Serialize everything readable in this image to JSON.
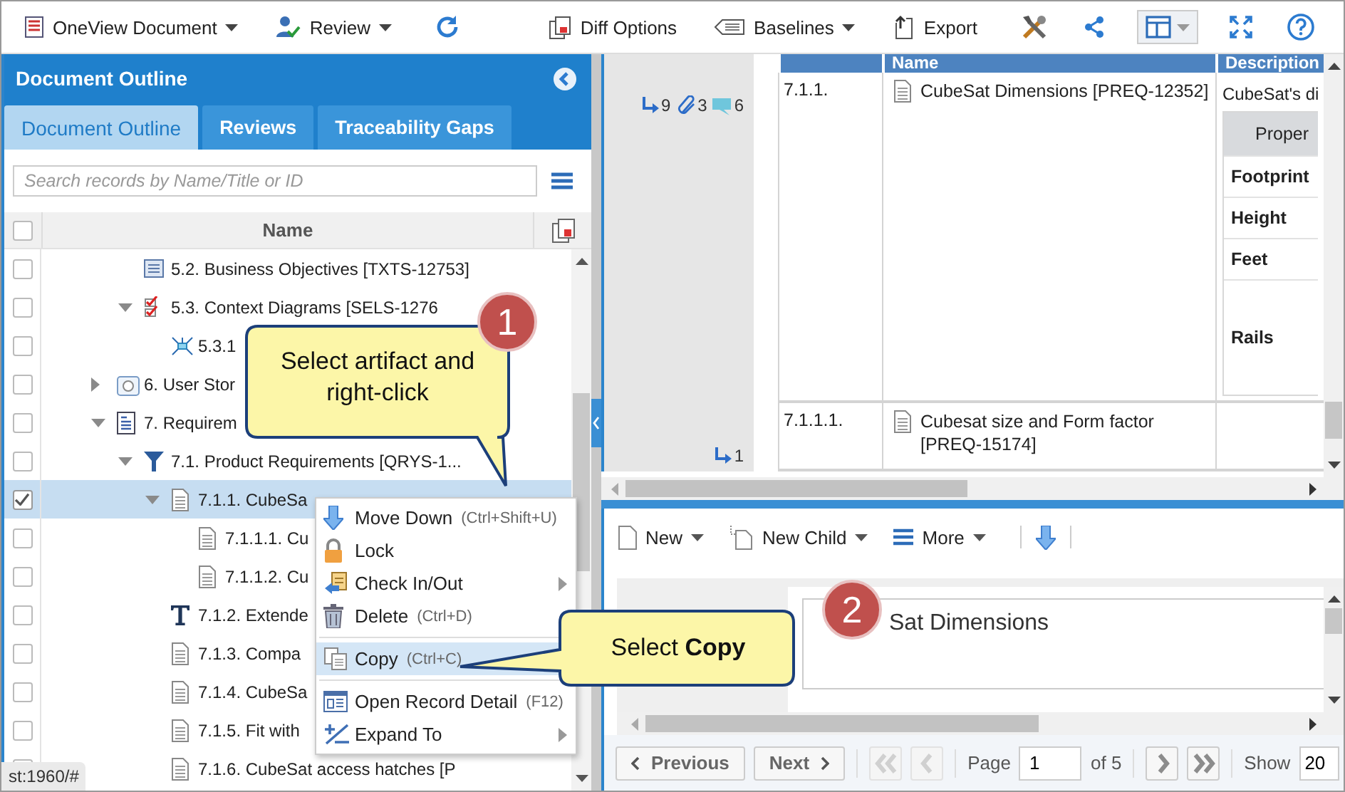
{
  "toolbar": {
    "left": [
      {
        "label": "OneView Document",
        "dropdown": true
      },
      {
        "label": "Review",
        "dropdown": true
      }
    ],
    "right": [
      {
        "label": "Diff Options",
        "dropdown": false
      },
      {
        "label": "Baselines",
        "dropdown": true
      },
      {
        "label": "Export",
        "dropdown": false
      }
    ]
  },
  "outline": {
    "title": "Document Outline",
    "tabs": [
      {
        "label": "Document Outline",
        "selected": true
      },
      {
        "label": "Reviews",
        "selected": false
      },
      {
        "label": "Traceability Gaps",
        "selected": false
      }
    ],
    "search": {
      "placeholder": "Search records by Name/Title or ID"
    },
    "column": "Name",
    "all_checked": false,
    "tree": [
      {
        "children": [
          {
            "label": "5.2. Business Objectives [TXTS-12753]",
            "kind": "text-list",
            "checked": false,
            "selected": false
          },
          {
            "label": "5.3. Context Diagrams [SELS-1276",
            "kind": "checklist",
            "expanded": true,
            "checked": false,
            "selected": false,
            "children": [
              {
                "label": "5.3.1",
                "kind": "diagram",
                "checked": false,
                "selected": false
              }
            ]
          }
        ]
      },
      {
        "label": "6. User Stor",
        "kind": "story",
        "expanded": false,
        "checked": false,
        "selected": false
      },
      {
        "label": "7. Requirem",
        "kind": "spec",
        "expanded": true,
        "checked": false,
        "selected": false,
        "children": [
          {
            "label": "7.1. Product Requirements [QRYS-1...",
            "kind": "filter",
            "expanded": true,
            "checked": false,
            "selected": false,
            "children": [
              {
                "label": "7.1.1. CubeSa",
                "kind": "page",
                "expanded": true,
                "checked": true,
                "selected": true,
                "children": [
                  {
                    "label": "7.1.1.1. Cu",
                    "kind": "page",
                    "checked": false,
                    "selected": false
                  },
                  {
                    "label": "7.1.1.2. Cu",
                    "kind": "page",
                    "checked": false,
                    "selected": false
                  }
                ]
              },
              {
                "label": "7.1.2. Extende",
                "kind": "text",
                "checked": false,
                "selected": false
              },
              {
                "label": "7.1.3. Compa",
                "kind": "page",
                "checked": false,
                "selected": false
              },
              {
                "label": "7.1.4. CubeSa",
                "kind": "page",
                "checked": false,
                "selected": false
              },
              {
                "label": "7.1.5. Fit with",
                "kind": "page",
                "checked": false,
                "selected": false
              },
              {
                "label": "7.1.6. CubeSat access hatches [P",
                "kind": "page",
                "checked": false,
                "selected": false
              }
            ]
          }
        ]
      }
    ]
  },
  "status_url": "st:1960/#",
  "context_menu": [
    {
      "kind": "move-down",
      "label": "Move Down",
      "shortcut": "(Ctrl+Shift+U)",
      "submenu": false,
      "selected": false
    },
    {
      "kind": "lock",
      "label": "Lock",
      "submenu": false,
      "selected": false
    },
    {
      "kind": "check-in",
      "label": "Check In/Out",
      "submenu": true,
      "selected": false
    },
    {
      "kind": "delete",
      "label": "Delete",
      "shortcut": "(Ctrl+D)",
      "submenu": false,
      "selected": false
    },
    {
      "kind": "divider"
    },
    {
      "kind": "copy",
      "label": "Copy",
      "shortcut": "(Ctrl+C)",
      "submenu": false,
      "selected": true
    },
    {
      "kind": "divider"
    },
    {
      "kind": "detail",
      "label": "Open Record Detail",
      "shortcut": "(F12)",
      "submenu": false,
      "selected": false
    },
    {
      "kind": "expand",
      "label": "Expand To",
      "submenu": true,
      "selected": false
    }
  ],
  "callouts": [
    {
      "step": "1",
      "text": "Select artifact and right-click"
    },
    {
      "step": "2",
      "text": "Select **Copy**"
    }
  ],
  "grid": {
    "columns": [
      "Name",
      "Description"
    ],
    "rows": [
      {
        "links": "9",
        "attachments": "3",
        "comments": "6",
        "number": "7.1.1.",
        "name": "CubeSat Dimensions [PREQ-12352]",
        "description": "CubeSat's di",
        "properties": {
          "header": "Proper",
          "rows": [
            "Footprint",
            "Height",
            "Feet",
            "Rails"
          ]
        }
      },
      {
        "links": "1",
        "number": "7.1.1.1.",
        "name": "Cubesat size and Form factor [PREQ-15174]"
      }
    ]
  },
  "detail": {
    "toolbar": [
      "New",
      "New Child",
      "More"
    ],
    "title": "Sat Dimensions"
  },
  "pager": {
    "previous": "Previous",
    "next": "Next",
    "nav_before": [
      {
        "kind": "first",
        "disabled": true
      },
      {
        "kind": "prev",
        "disabled": true
      }
    ],
    "page_label": "Page",
    "page": "1",
    "of": "of 5",
    "nav_after": [
      {
        "kind": "next",
        "disabled": false
      },
      {
        "kind": "last",
        "disabled": false
      }
    ],
    "show_label": "Show",
    "show": "20"
  }
}
